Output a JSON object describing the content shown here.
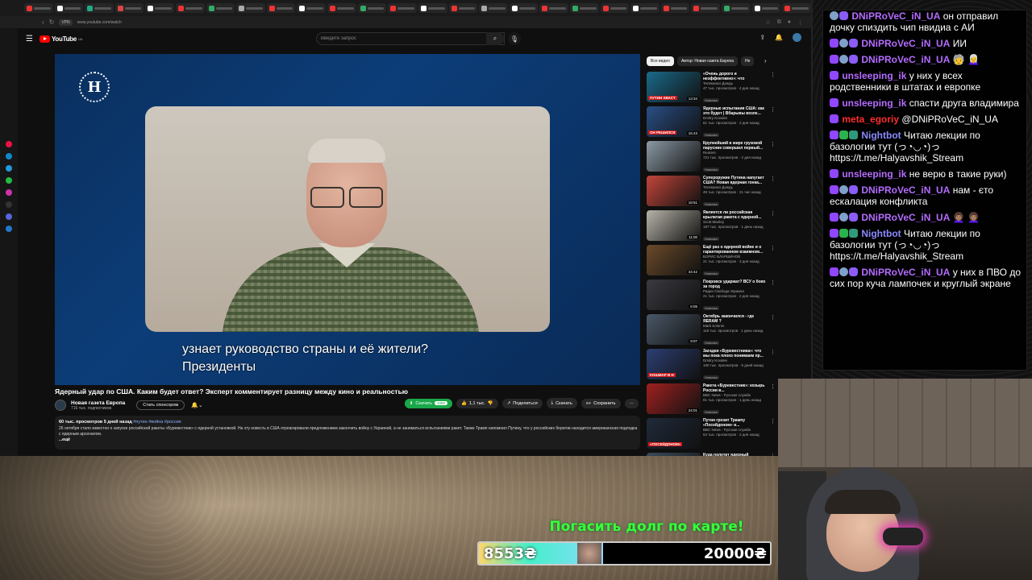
{
  "browser": {
    "url": "www.youtube.com/watch",
    "tab_colors": [
      "#e33",
      "#fff",
      "#2a8",
      "#d44",
      "#fff",
      "#e33",
      "#3a6",
      "#aaa",
      "#e33",
      "#fff",
      "#e33",
      "#3a6",
      "#e33",
      "#fff",
      "#e33",
      "#aaa",
      "#fff",
      "#e33",
      "#3a6",
      "#e33",
      "#fff",
      "#e33",
      "#e33",
      "#3a6",
      "#fff",
      "#e33"
    ]
  },
  "youtube": {
    "logo_text": "YouTube",
    "logo_sup": "UA",
    "search_placeholder": "Введите запрос",
    "video": {
      "title": "Ядерный удар по США. Каким будет ответ? Эксперт комментирует разницу между кино и реальностью",
      "subtitle": "узнает руководство страны и её жители?\nПрезиденты",
      "player_logo": "Н",
      "channel": "Новая газета Европа",
      "subscribers": "716 тыс. подписчиков",
      "sponsor_label": "Стать спонсором",
      "actions": {
        "download_green": "Скачать",
        "download_badge": "1080",
        "likes": "1,1 тыс.",
        "share": "Поделиться",
        "download": "Скачать",
        "save": "Сохранить"
      },
      "description": {
        "stats": "60 тыс. просмотров  5 дней назад",
        "tags": "#путин #война #россия",
        "text": "26 октября стало известно о запуске российской ракеты «Буревестник» с ядерной установкой. На эту новость в США отреагировали предложением закончить войну с Украиной, а не заниматься испытаниями ракет. Также Трамп напомнил Путину, что у российских берегов находится американская подлодка с ядерным арсеналом.",
        "more": "...ещё"
      }
    },
    "chips": [
      "Все видео",
      "Автор: Новая газета Европа",
      "Не"
    ],
    "recommendations": [
      {
        "title": "«Очень дорого и неэффективно»: что известно...",
        "channel": "Телеканал Дождь",
        "meta": "47 тыс. просмотров · 4 дня назад",
        "duration": "13:34",
        "caption": "ПУТИН ХВАСТ",
        "thumb": "#1a6a8a",
        "new": "Новинка"
      },
      {
        "title": "Ядерные испытания США: как это будет | Вбарывы возле...",
        "channel": "Dmitry Kovalev",
        "meta": "61 тыс. просмотров · 2 дня назад",
        "duration": "15:43",
        "caption": "ОН РЕШИЛСЯ",
        "thumb": "#2a4f85",
        "new": "Новинка"
      },
      {
        "title": "Крупнейший в мире грузовой парусник совершил первый...",
        "channel": "Reuters",
        "meta": "721 тыс. просмотров · 2 дня назад",
        "duration": "",
        "caption": "",
        "thumb": "#8b9aa6",
        "new": "Новинка"
      },
      {
        "title": "Супероружие Путина напугает США? Новая ядерная гонка...",
        "channel": "Телеканал Дождь",
        "meta": "49 тыс. просмотров · 21 час назад",
        "duration": "18:51",
        "caption": "",
        "thumb": "#c2453a",
        "new": "Новинка"
      },
      {
        "title": "Является ли российская крылатая ракета с ядерной...",
        "channel": "Scott Manley",
        "meta": "187 тыс. просмотров · 1 день назад",
        "duration": "11:00",
        "caption": "",
        "thumb": "#b7b4a9",
        "new": "Новинка"
      },
      {
        "title": "Ещё раз о ядерной войне и о гарантированном взаимном...",
        "channel": "БОРИС БЛАРШИНОВ",
        "meta": "21 тыс. просмотров · 3 дня назад",
        "duration": "34:42",
        "caption": "",
        "thumb": "#6b4a2a",
        "new": "Новинка"
      },
      {
        "title": "Покровск ударжат? ВСУ о боях за город",
        "channel": "Радио Свобода Украина",
        "meta": "21 тыс. просмотров · 2 дня назад",
        "duration": "6:05",
        "caption": "",
        "thumb": "#3a3a40",
        "new": "Новинка"
      },
      {
        "title": "Октябрь закончился - где ЯЕRAM ?",
        "channel": "Mark Solonin",
        "meta": "118 тыс. просмотров · 1 день назад",
        "duration": "9:07",
        "caption": "",
        "thumb": "#4a5868",
        "new": "Новинка"
      },
      {
        "title": "Загадки «Буревестника»: что мы пока плохо понимаем пр...",
        "channel": "Dmitry Kovalev",
        "meta": "100 тыс. просмотров · 6 дней назад",
        "duration": "",
        "caption": "КОШМАР В Н",
        "thumb": "#2d3f73",
        "new": "Новинка"
      },
      {
        "title": "Ракета «Буревестник»: козырь России в...",
        "channel": "BBC News - Русская служба",
        "meta": "81 тыс. просмотров · 1 день назад",
        "duration": "24:01",
        "caption": "",
        "thumb": "#a02020",
        "new": "Новинка"
      },
      {
        "title": "Путин грозит Трампу «Посейдоном» и...",
        "channel": "BBC News - Русская служба",
        "meta": "54 тыс. просмотров · 2 дня назад",
        "duration": "",
        "caption": "«ПОСЕЙДОНОМ»",
        "thumb": "#1f2a3a",
        "new": ""
      },
      {
        "title": "Куда полетит ядерный",
        "channel": "",
        "meta": "",
        "duration": "",
        "caption": "",
        "thumb": "#3a4a5a",
        "new": ""
      }
    ]
  },
  "chat": {
    "messages": [
      {
        "user": "DNiPRoVeC_iN_UA",
        "color": "#b46cff",
        "badges": [
          "gear",
          "game"
        ],
        "text": "он отправил дочку спиздить чип нвидиа с АИ"
      },
      {
        "user": "DNiPRoVeC_iN_UA",
        "color": "#b46cff",
        "badges": [
          "twitch",
          "gear",
          "game"
        ],
        "text": "ИИ"
      },
      {
        "user": "DNiPRoVeC_iN_UA",
        "color": "#b46cff",
        "badges": [
          "twitch",
          "gear",
          "game"
        ],
        "text": "🧓 👩‍🦳"
      },
      {
        "user": "unsleeping_ik",
        "color": "#b46cff",
        "badges": [
          "twitch"
        ],
        "text": "у них у всех родственники в штатах и европке"
      },
      {
        "user": "unsleeping_ik",
        "color": "#b46cff",
        "badges": [
          "twitch"
        ],
        "text": "спасти друга владимира"
      },
      {
        "user": "meta_egoriy",
        "color": "#ff2e2e",
        "badges": [
          "twitch"
        ],
        "text": "@DNiPRoVeC_iN_UA"
      },
      {
        "user": "Nightbot",
        "color": "#8a8aff",
        "badges": [
          "twitch",
          "check",
          "bot"
        ],
        "text": "Читаю лекции по базологии тут (っ◔◡◔)っ https://t.me/Halyavshik_Stream"
      },
      {
        "user": "unsleeping_ik",
        "color": "#b46cff",
        "badges": [
          "twitch"
        ],
        "text": "не верю в такие руки)"
      },
      {
        "user": "DNiPRoVeC_iN_UA",
        "color": "#b46cff",
        "badges": [
          "twitch",
          "gear",
          "game"
        ],
        "text": "нам - єто ескалация конфликта"
      },
      {
        "user": "DNiPRoVeC_iN_UA",
        "color": "#b46cff",
        "badges": [
          "twitch",
          "gear",
          "game"
        ],
        "text": "👩🏽‍🦱 👩🏽‍🦱"
      },
      {
        "user": "Nightbot",
        "color": "#8a8aff",
        "badges": [
          "twitch",
          "check",
          "bot"
        ],
        "text": "Читаю лекции по базологии тут (っ◔◡◔)っ https://t.me/Halyavshik_Stream"
      },
      {
        "user": "DNiPRoVeC_iN_UA",
        "color": "#b46cff",
        "badges": [
          "twitch",
          "gear",
          "game"
        ],
        "text": "у них в ПВО до сих пор куча лампочек и круглый экране"
      }
    ]
  },
  "donation": {
    "title": "Погасить долг по карте!",
    "current": "8553₴",
    "goal": "20000₴",
    "progress": 0.4277
  }
}
